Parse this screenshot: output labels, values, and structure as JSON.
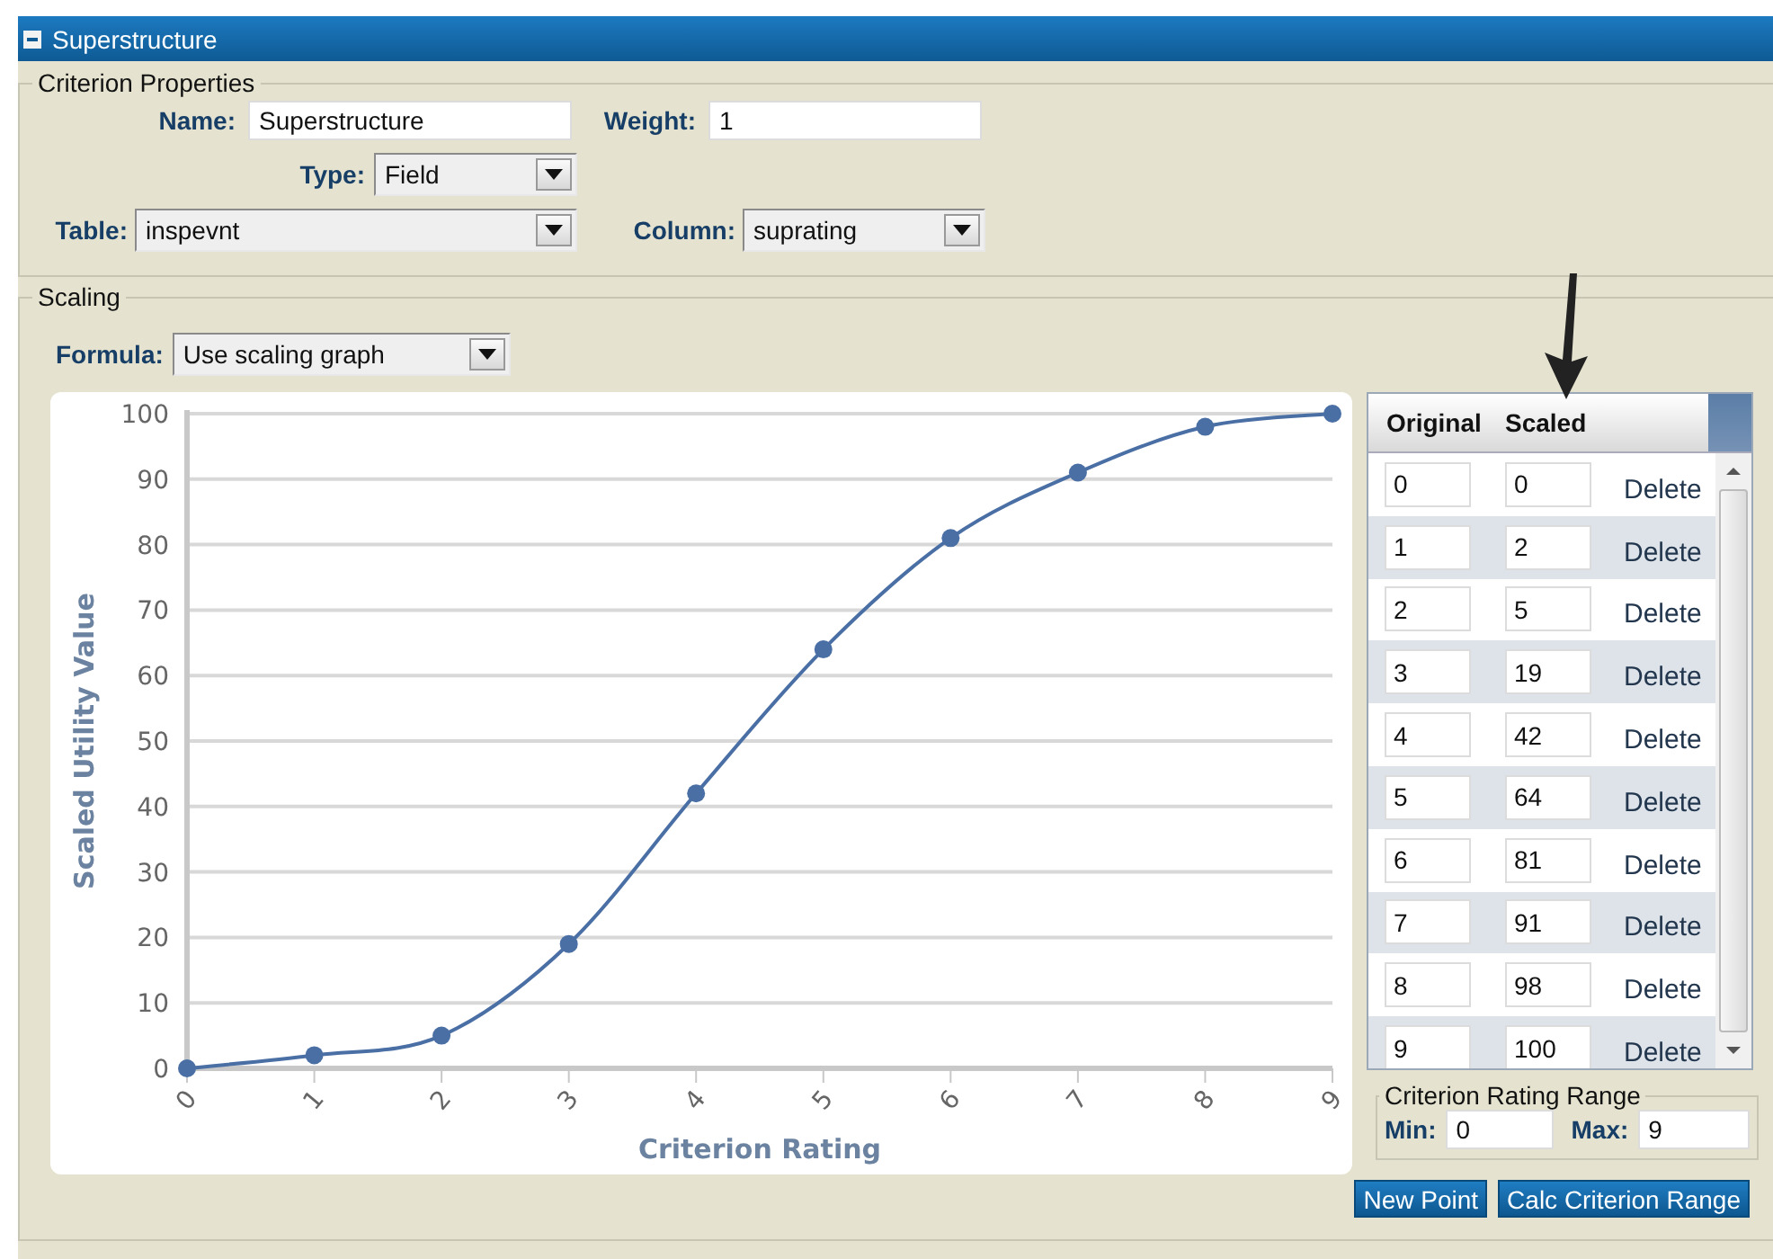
{
  "panel": {
    "title": "Superstructure",
    "expanded": true
  },
  "criterion_properties": {
    "legend": "Criterion Properties",
    "rows": [
      {
        "fields": [
          {
            "label": "Name:",
            "value": "Superstructure",
            "kind": "text"
          },
          {
            "label": "Weight:",
            "value": "1",
            "kind": "text"
          }
        ]
      },
      {
        "fields": [
          {
            "label": "Type:",
            "value": "Field",
            "kind": "select"
          }
        ]
      },
      {
        "fields": [
          {
            "label": "Table:",
            "value": "inspevnt",
            "kind": "select"
          },
          {
            "label": "Column:",
            "value": "suprating",
            "kind": "select"
          }
        ]
      }
    ]
  },
  "scaling": {
    "legend": "Scaling",
    "formula": {
      "label": "Formula:",
      "value": "Use scaling graph"
    },
    "chart_data": {
      "type": "line",
      "xlabel": "Criterion Rating",
      "ylabel": "Scaled Utility Value",
      "categories": [
        "0",
        "1",
        "2",
        "3",
        "4",
        "5",
        "6",
        "7",
        "8",
        "9"
      ],
      "series": [
        {
          "color": "#4a6fa5",
          "marker": true,
          "values": [
            0,
            2,
            5,
            19,
            42,
            64,
            81,
            91,
            98,
            100
          ]
        }
      ],
      "grid": true,
      "ylim": [
        0,
        100
      ],
      "yticks": [
        0,
        10,
        20,
        30,
        40,
        50,
        60,
        70,
        80,
        90,
        100
      ]
    },
    "points_table": {
      "columns": [
        "Original",
        "Scaled"
      ],
      "rows": [
        {
          "original": "0",
          "scaled": "0",
          "action": "Delete"
        },
        {
          "original": "1",
          "scaled": "2",
          "action": "Delete"
        },
        {
          "original": "2",
          "scaled": "5",
          "action": "Delete"
        },
        {
          "original": "3",
          "scaled": "19",
          "action": "Delete"
        },
        {
          "original": "4",
          "scaled": "42",
          "action": "Delete"
        },
        {
          "original": "5",
          "scaled": "64",
          "action": "Delete"
        },
        {
          "original": "6",
          "scaled": "81",
          "action": "Delete"
        },
        {
          "original": "7",
          "scaled": "91",
          "action": "Delete"
        },
        {
          "original": "8",
          "scaled": "98",
          "action": "Delete"
        },
        {
          "original": "9",
          "scaled": "100",
          "action": "Delete"
        }
      ]
    },
    "range": {
      "legend": "Criterion Rating Range",
      "min_label": "Min:",
      "min": "0",
      "max_label": "Max:",
      "max": "9"
    },
    "buttons": [
      "New Point",
      "Calc Criterion Range"
    ]
  }
}
